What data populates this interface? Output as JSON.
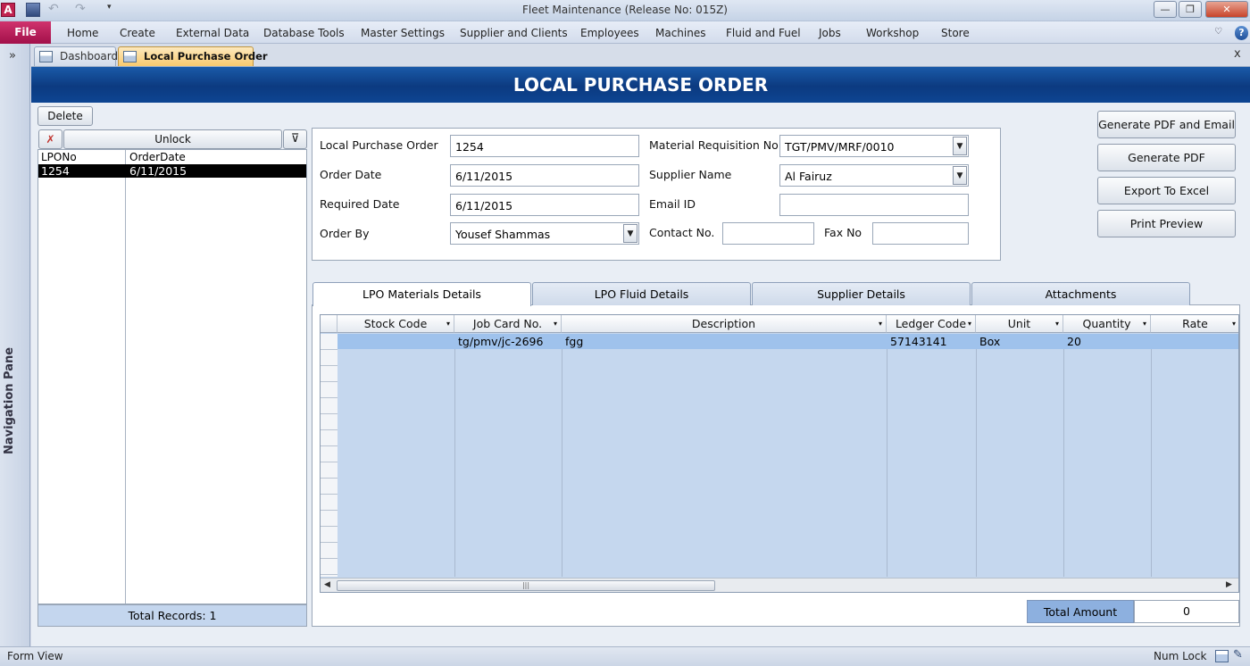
{
  "window": {
    "title": "Fleet Maintenance (Release No: 015Z)"
  },
  "ribbon": {
    "file": "File",
    "tabs": [
      "Home",
      "Create",
      "External Data",
      "Database Tools",
      "Master Settings",
      "Supplier and Clients",
      "Employees",
      "Machines",
      "Fluid and Fuel",
      "Jobs",
      "Workshop",
      "Store"
    ]
  },
  "nav": {
    "toggle": "»",
    "label": "Navigation Pane"
  },
  "doc_tabs": [
    "Dashboard",
    "Local Purchase Order"
  ],
  "doc_close": "x",
  "form": {
    "header": "LOCAL PURCHASE ORDER",
    "delete_label": "Delete",
    "unlock_label": "Unlock",
    "list": {
      "columns": [
        "LPONo",
        "OrderDate"
      ],
      "rows": [
        {
          "lpo": "1254",
          "date": "6/11/2015"
        }
      ],
      "total": "Total Records: 1"
    },
    "fields": {
      "lpo_label": "Local Purchase Order",
      "lpo_value": "1254",
      "order_date_label": "Order Date",
      "order_date_value": "6/11/2015",
      "required_date_label": "Required Date",
      "required_date_value": "6/11/2015",
      "order_by_label": "Order By",
      "order_by_value": "Yousef Shammas",
      "mrn_label": "Material Requisition No",
      "mrn_value": "TGT/PMV/MRF/0010",
      "supplier_label": "Supplier Name",
      "supplier_value": "Al Fairuz",
      "email_label": "Email ID",
      "email_value": "",
      "contact_label": "Contact No.",
      "contact_value": "",
      "fax_label": "Fax No",
      "fax_value": ""
    },
    "actions": {
      "pdf_email": "Generate PDF and Email",
      "pdf": "Generate PDF",
      "excel": "Export To Excel",
      "preview": "Print Preview"
    },
    "tabs": [
      "LPO Materials Details",
      "LPO Fluid Details",
      "Supplier Details",
      "Attachments"
    ],
    "grid": {
      "columns": [
        "Stock Code",
        "Job Card No.",
        "Description",
        "Ledger Code",
        "Unit",
        "Quantity",
        "Rate"
      ],
      "rows": [
        {
          "stock_code": "",
          "job_card": "tg/pmv/jc-2696",
          "description": "fgg",
          "ledger_code": "57143141",
          "unit": "Box",
          "quantity": "20",
          "rate": ""
        }
      ]
    },
    "total_label": "Total Amount",
    "total_value": "0"
  },
  "status": {
    "view": "Form View",
    "numlock": "Num Lock"
  }
}
